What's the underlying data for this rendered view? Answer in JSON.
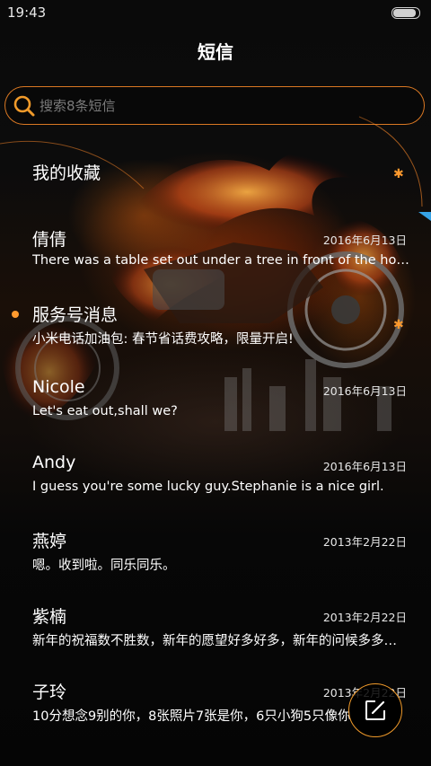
{
  "status_bar": {
    "time": "19:43",
    "battery_level": 0.9
  },
  "header": {
    "title": "短信"
  },
  "search": {
    "placeholder": "搜索8条短信"
  },
  "conversations": [
    {
      "name": "我的收藏",
      "date": "",
      "preview": "",
      "unread": false
    },
    {
      "name": "倩倩",
      "date": "2016年6月13日",
      "preview": "There was a table set out under a tree in front of the house",
      "unread": false
    },
    {
      "name": "服务号消息",
      "date": "",
      "preview": "小米电话加油包: 春节省话费攻略，限量开启!",
      "unread": true
    },
    {
      "name": "Nicole",
      "date": "2016年6月13日",
      "preview": "Let's eat out,shall we?",
      "unread": false
    },
    {
      "name": "Andy",
      "date": "2016年6月13日",
      "preview": "I guess you're some lucky guy.Stephanie is a nice girl.",
      "unread": false
    },
    {
      "name": "燕婷",
      "date": "2013年2月22日",
      "preview": "嗯。收到啦。同乐同乐。",
      "unread": false
    },
    {
      "name": "紫楠",
      "date": "2013年2月22日",
      "preview": "新年的祝福数不胜数，新年的愿望好多好多，新年的问候多多多多",
      "unread": false
    },
    {
      "name": "子玲",
      "date": "2013年2月22日",
      "preview": "10分想念9别的你，8张照片7张是你，6只小狗5只像你",
      "unread": false
    }
  ],
  "colors": {
    "accent": "#f09a2a",
    "unread_dot": "#ff9a2e",
    "text": "#ffffff"
  },
  "icons": {
    "search": "search-icon",
    "compose": "compose-icon"
  }
}
